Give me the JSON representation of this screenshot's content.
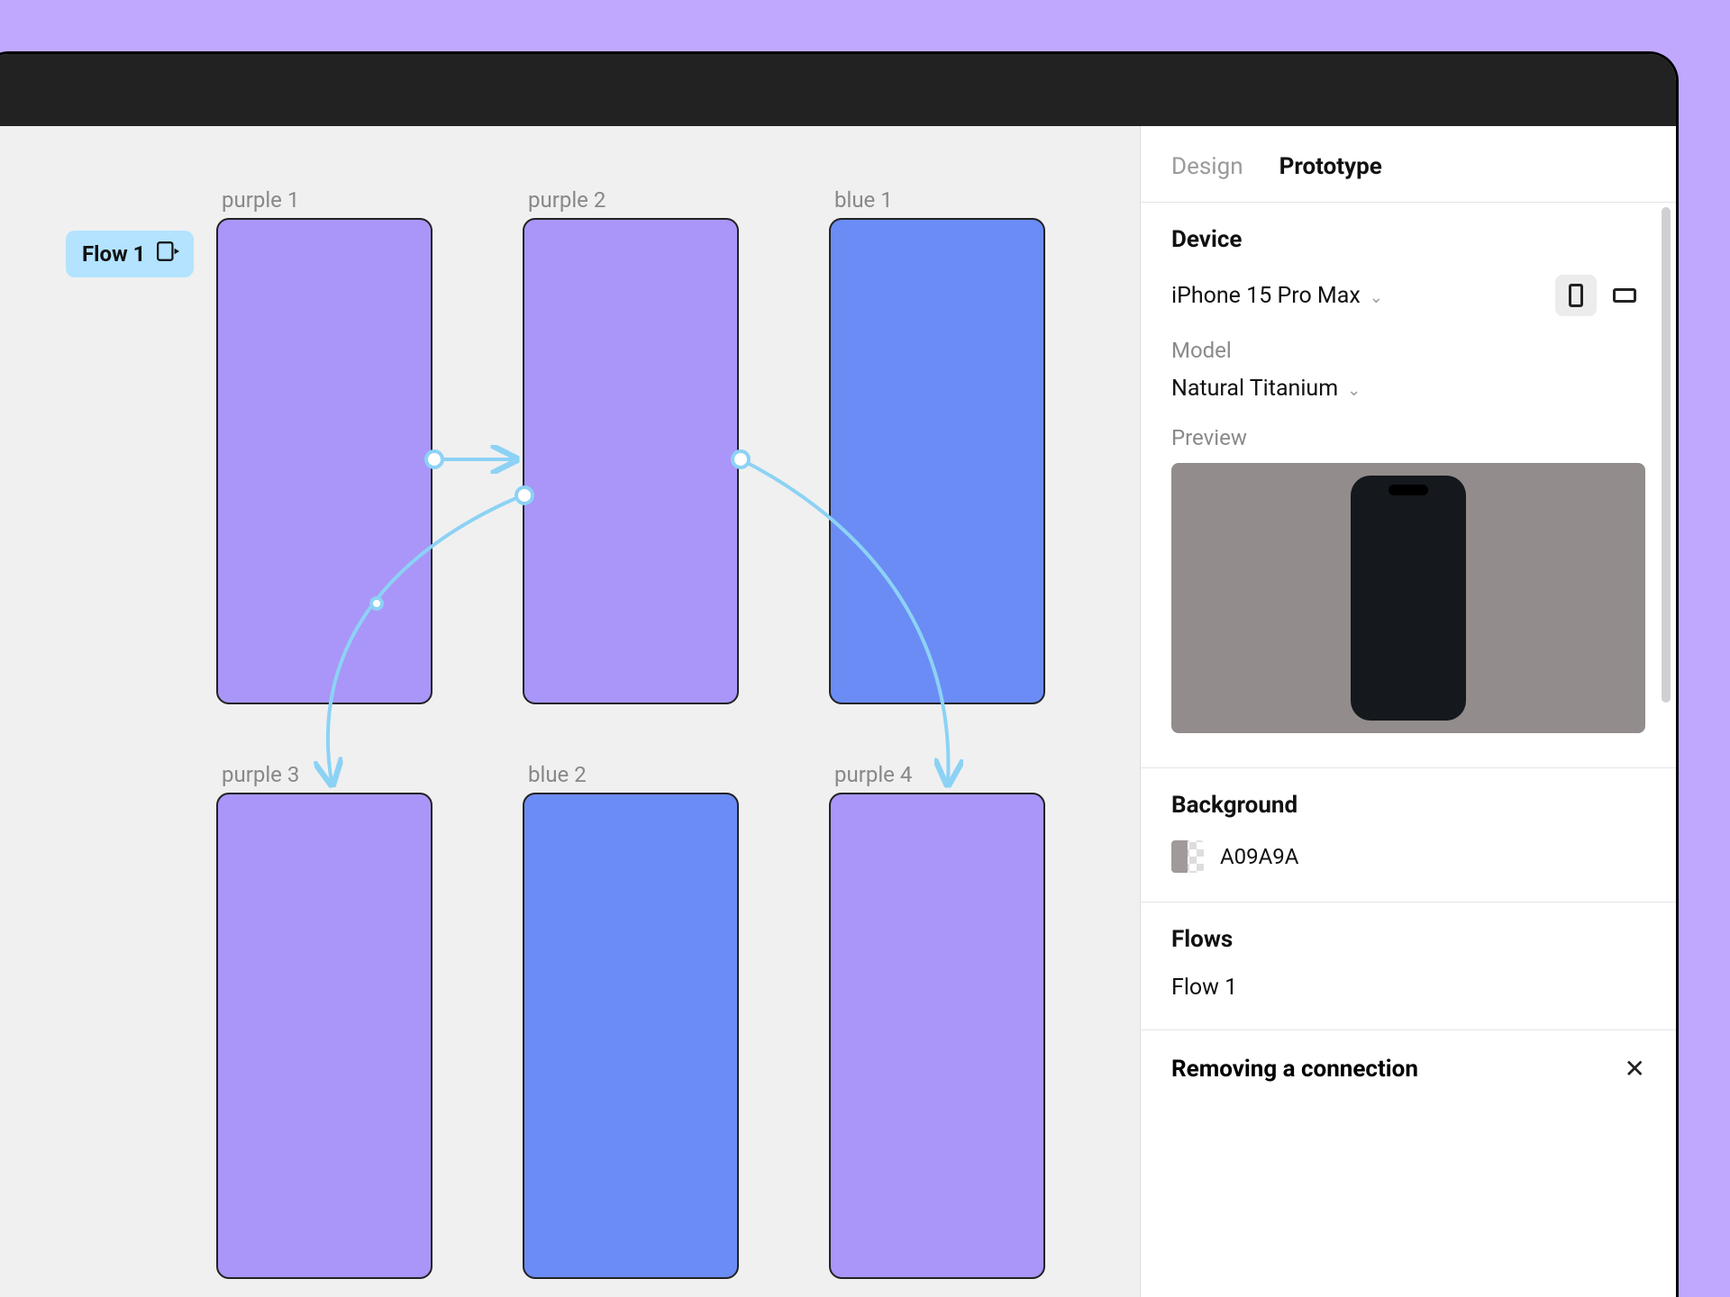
{
  "canvas": {
    "flow_badge": "Flow 1",
    "frames": [
      {
        "id": "purple1",
        "label": "purple 1"
      },
      {
        "id": "purple2",
        "label": "purple 2"
      },
      {
        "id": "blue1",
        "label": "blue 1"
      },
      {
        "id": "purple3",
        "label": "purple 3"
      },
      {
        "id": "blue2",
        "label": "blue 2"
      },
      {
        "id": "purple4",
        "label": "purple 4"
      }
    ]
  },
  "inspector": {
    "tabs": {
      "design": "Design",
      "prototype": "Prototype",
      "active": "prototype"
    },
    "device": {
      "section_title": "Device",
      "selected": "iPhone 15 Pro Max",
      "model_label": "Model",
      "model_selected": "Natural Titanium",
      "preview_label": "Preview",
      "orientation": "portrait"
    },
    "background": {
      "section_title": "Background",
      "value": "A09A9A"
    },
    "flows": {
      "section_title": "Flows",
      "items": [
        "Flow 1"
      ]
    },
    "notification": {
      "title": "Removing a connection"
    }
  }
}
